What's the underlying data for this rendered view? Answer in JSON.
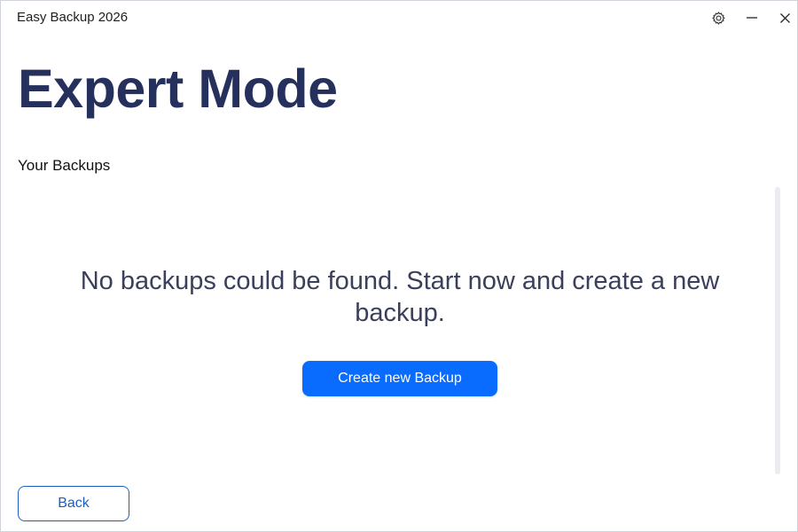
{
  "window": {
    "title": "Easy Backup 2026"
  },
  "titlebar": {
    "settings_icon": "gear-icon",
    "minimize_icon": "minimize-icon",
    "close_icon": "close-icon"
  },
  "page": {
    "title": "Expert Mode",
    "section_title": "Your Backups"
  },
  "backups": {
    "items": [],
    "empty_message": "No backups could be found. Start now and create a new backup.",
    "create_button_label": "Create new Backup"
  },
  "footer": {
    "back_button_label": "Back"
  },
  "colors": {
    "title": "#26305c",
    "primary": "#0a6cff",
    "outline_button": "#1a5fbf",
    "message_text": "#3a3f5c"
  }
}
